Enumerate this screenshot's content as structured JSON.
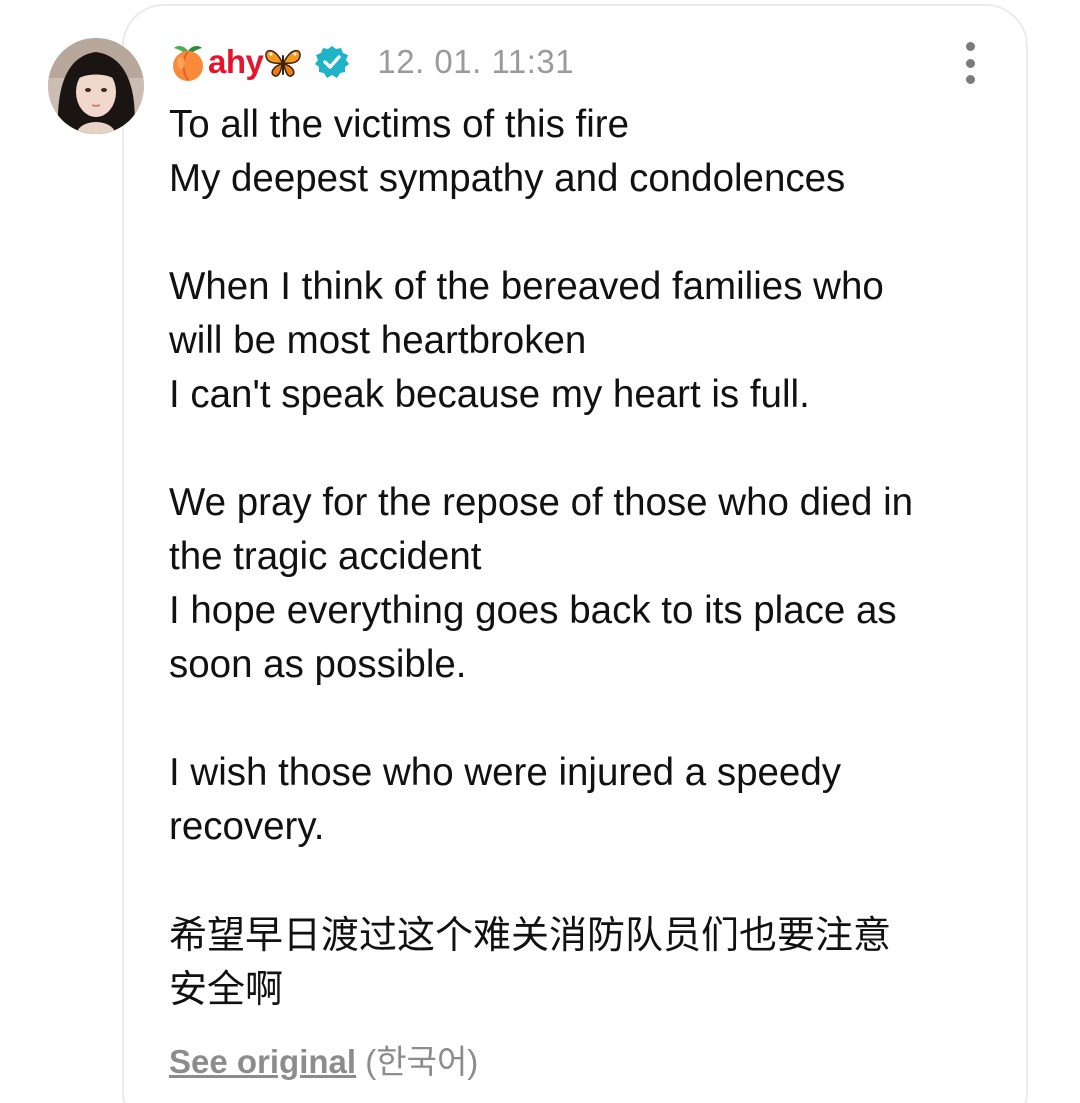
{
  "post": {
    "username": "ahy",
    "username_prefix_icon": "peach-emoji-icon",
    "username_suffix_icon": "butterfly-emoji-icon",
    "verified_icon": "verified-badge-icon",
    "timestamp": "12. 01. 11:31",
    "more_icon": "more-vertical-icon",
    "body_lines": [
      "To all the victims of this fire",
      "My deepest sympathy and condolences",
      "",
      "When I think of the bereaved families who",
      "will be most heartbroken",
      "I can't speak because my heart is full.",
      "",
      "We pray for the repose of those who died in",
      "the tragic accident",
      "I hope everything goes back to its place as",
      "soon as possible.",
      "",
      "I wish those who were injured a speedy",
      "recovery.",
      "",
      "希望早日渡过这个难关消防队员们也要注意",
      "安全啊"
    ],
    "see_original_label": "See original",
    "original_language": "(한국어)"
  },
  "colors": {
    "username": "#e8132a",
    "verified": "#1fb3c7",
    "timestamp": "#9a9a9a",
    "body_text": "#111111",
    "card_border": "#ebebeb"
  }
}
